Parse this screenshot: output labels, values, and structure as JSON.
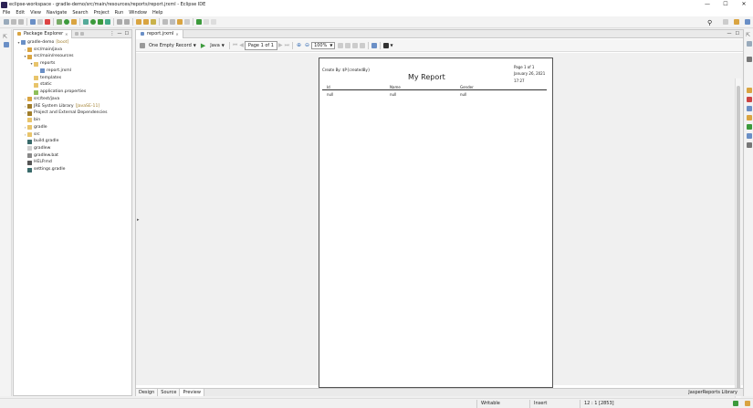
{
  "window": {
    "title": "eclipse-workspace - gradle-demo/src/main/resources/reports/report.jrxml - Eclipse IDE"
  },
  "menu": [
    "File",
    "Edit",
    "View",
    "Navigate",
    "Search",
    "Project",
    "Run",
    "Window",
    "Help"
  ],
  "explorer": {
    "tab_label": "Package Explorer",
    "items": [
      {
        "label": "gradle-demo",
        "deco": "[boot]",
        "arrow": "▾",
        "icon": "project-icon",
        "depth": 0
      },
      {
        "label": "src/main/java",
        "deco": "",
        "arrow": "›",
        "icon": "source-folder-icon",
        "depth": 1
      },
      {
        "label": "src/main/resources",
        "deco": "",
        "arrow": "▾",
        "icon": "source-folder-icon",
        "depth": 1
      },
      {
        "label": "reports",
        "deco": "",
        "arrow": "▾",
        "icon": "folder-icon",
        "depth": 2
      },
      {
        "label": "report.jrxml",
        "deco": "",
        "arrow": "",
        "icon": "jrxml-file-icon",
        "depth": 3
      },
      {
        "label": "templates",
        "deco": "",
        "arrow": "",
        "icon": "folder-icon",
        "depth": 2
      },
      {
        "label": "static",
        "deco": "",
        "arrow": "",
        "icon": "folder-icon",
        "depth": 2
      },
      {
        "label": "application.properties",
        "deco": "",
        "arrow": "",
        "icon": "properties-file-icon",
        "depth": 2
      },
      {
        "label": "src/test/java",
        "deco": "",
        "arrow": "›",
        "icon": "source-folder-icon",
        "depth": 1
      },
      {
        "label": "JRE System Library",
        "deco": "[JavaSE-11]",
        "arrow": "›",
        "icon": "library-icon",
        "depth": 1
      },
      {
        "label": "Project and External Dependencies",
        "deco": "",
        "arrow": "›",
        "icon": "library-icon",
        "depth": 1
      },
      {
        "label": "bin",
        "deco": "",
        "arrow": "",
        "icon": "folder-icon",
        "depth": 1
      },
      {
        "label": "gradle",
        "deco": "",
        "arrow": "›",
        "icon": "folder-icon",
        "depth": 1
      },
      {
        "label": "src",
        "deco": "",
        "arrow": "›",
        "icon": "folder-icon",
        "depth": 1
      },
      {
        "label": "build.gradle",
        "deco": "",
        "arrow": "",
        "icon": "gradle-file-icon",
        "depth": 1
      },
      {
        "label": "gradlew",
        "deco": "",
        "arrow": "",
        "icon": "file-icon",
        "depth": 1
      },
      {
        "label": "gradlew.bat",
        "deco": "",
        "arrow": "",
        "icon": "bat-file-icon",
        "depth": 1
      },
      {
        "label": "HELP.md",
        "deco": "",
        "arrow": "",
        "icon": "markdown-file-icon",
        "depth": 1
      },
      {
        "label": "settings.gradle",
        "deco": "",
        "arrow": "",
        "icon": "gradle-file-icon",
        "depth": 1
      }
    ]
  },
  "editor": {
    "tab_label": "report.jrxml",
    "toolbar": {
      "record_label": "One Empty Record",
      "language_label": "Java",
      "page_label": "Page 1 of 1",
      "zoom_value": "100%"
    },
    "report": {
      "created_by": "Create By: $P{createdBy}",
      "title": "My Report",
      "page_info": "Page 1 of 1",
      "date": "January 26, 2021",
      "time": "17:27",
      "columns": [
        "Id",
        "Name",
        "Gender"
      ],
      "values": [
        "null",
        "null",
        "null"
      ]
    },
    "bottom_tabs": [
      "Design",
      "Source",
      "Preview"
    ],
    "library_label": "JasperReports Library"
  },
  "status": {
    "writable": "Writable",
    "insert_mode": "Insert",
    "position": "12 : 1 [2853]"
  },
  "colors": {
    "accent": "#2c2255",
    "folder": "#e8c46b",
    "source_folder": "#d9a441",
    "run_green": "#3c9a3c"
  }
}
